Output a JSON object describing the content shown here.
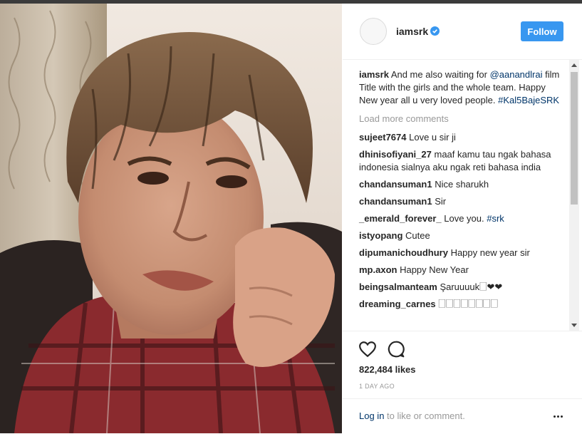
{
  "post": {
    "username": "iamsrk",
    "follow_label": "Follow",
    "caption": {
      "username": "iamsrk",
      "text_1": " And me also waiting for ",
      "mention": "@aanandlrai",
      "text_2": " film Title with the girls and the whole team. Happy New year all u very loved people. ",
      "hashtag": "#Kal5BajeSRK"
    },
    "load_more": "Load more comments",
    "comments": [
      {
        "user": "sujeet7674",
        "text": " Love u sir ji"
      },
      {
        "user": "dhinisofiyani_27",
        "text": " maaf kamu tau ngak bahasa indonesia sialnya aku ngak reti bahasa india"
      },
      {
        "user": "chandansuman1",
        "text": " Nice sharukh"
      },
      {
        "user": "chandansuman1",
        "text": " Sir"
      },
      {
        "user": "_emerald_forever_",
        "text": " Love you. ",
        "hashtag": "#srk"
      },
      {
        "user": "istyopang",
        "text": " Cutee"
      },
      {
        "user": "dipumanichoudhury",
        "text": " Happy new year sir"
      },
      {
        "user": "mp.axon",
        "text": " Happy New Year"
      },
      {
        "user": "beingsalmanteam",
        "text": " Şaruuuuk🗌❤❤"
      },
      {
        "user": "dreaming_carnes",
        "text": " 🗌🗌🗌🗌🗌🗌🗌🗌"
      }
    ],
    "likes": "822,484 likes",
    "time_ago": "1 DAY AGO",
    "login_link": "Log in",
    "login_rest": " to like or comment."
  },
  "colors": {
    "follow_bg": "#3897f0",
    "link": "#003569",
    "muted": "#999999",
    "verified": "#3897f0"
  },
  "icons": [
    "verified-badge-icon",
    "heart-icon",
    "comment-icon",
    "more-options-icon"
  ]
}
